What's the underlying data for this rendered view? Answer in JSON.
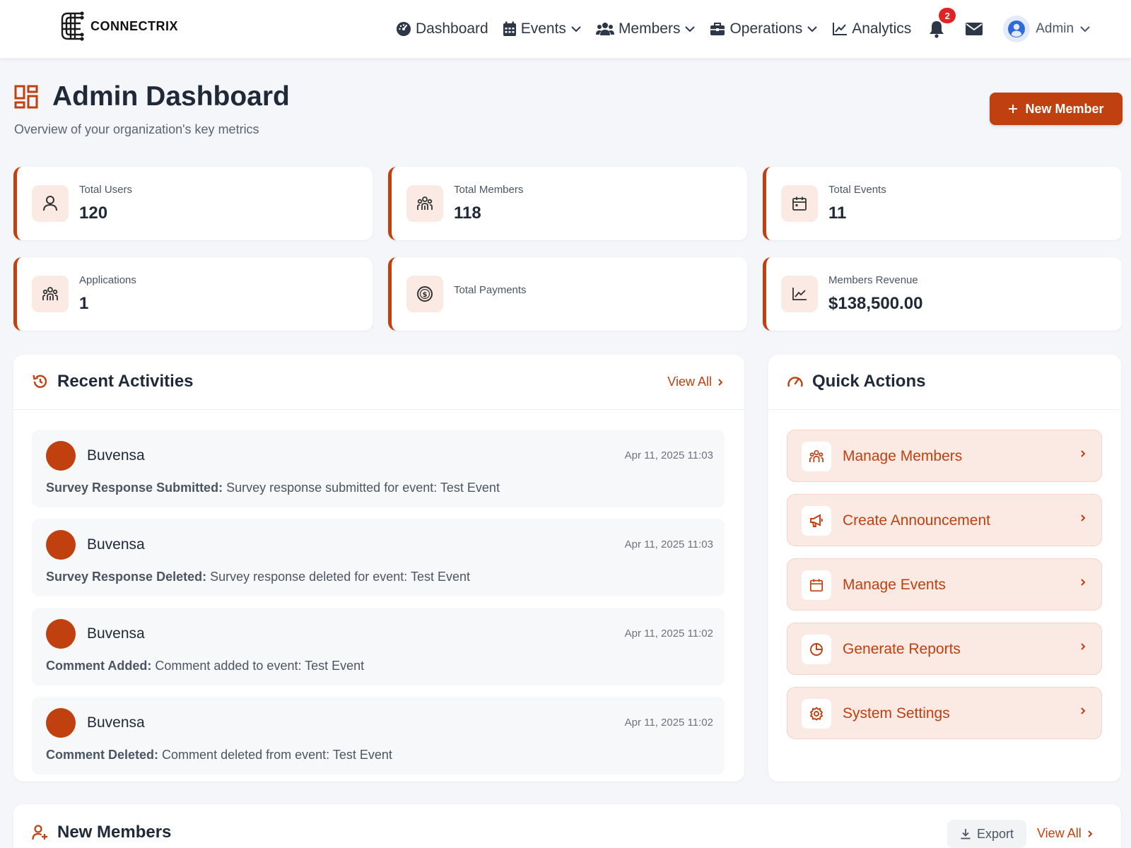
{
  "brand": {
    "name": "CONNECTRIX"
  },
  "nav": {
    "items": [
      {
        "label": "Dashboard",
        "icon": "gauge-icon",
        "dropdown": false
      },
      {
        "label": "Events",
        "icon": "calendar-grid-icon",
        "dropdown": true
      },
      {
        "label": "Members",
        "icon": "users-icon",
        "dropdown": true
      },
      {
        "label": "Operations",
        "icon": "briefcase-icon",
        "dropdown": true
      },
      {
        "label": "Analytics",
        "icon": "line-chart-icon",
        "dropdown": false
      }
    ],
    "notifications_count": "2",
    "user_label": "Admin"
  },
  "header": {
    "title": "Admin Dashboard",
    "subtitle": "Overview of your organization's key metrics",
    "new_member_label": "New Member"
  },
  "stats": [
    {
      "label": "Total Users",
      "value": "120",
      "icon": "user-icon"
    },
    {
      "label": "Total Members",
      "value": "118",
      "icon": "group-icon"
    },
    {
      "label": "Total Events",
      "value": "11",
      "icon": "calendar-icon"
    },
    {
      "label": "Applications",
      "value": "1",
      "icon": "group-icon"
    },
    {
      "label": "Total Payments",
      "value": "",
      "icon": "dollar-circle-icon"
    },
    {
      "label": "Members Revenue",
      "value": "$138,500.00",
      "icon": "trend-chart-icon"
    }
  ],
  "recent_activities": {
    "title": "Recent Activities",
    "view_all_label": "View All",
    "items": [
      {
        "user": "Buvensa",
        "time": "Apr 11, 2025 11:03",
        "action": "Survey Response Submitted:",
        "detail": "Survey response submitted for event: Test Event"
      },
      {
        "user": "Buvensa",
        "time": "Apr 11, 2025 11:03",
        "action": "Survey Response Deleted:",
        "detail": "Survey response deleted for event: Test Event"
      },
      {
        "user": "Buvensa",
        "time": "Apr 11, 2025 11:02",
        "action": "Comment Added:",
        "detail": "Comment added to event: Test Event"
      },
      {
        "user": "Buvensa",
        "time": "Apr 11, 2025 11:02",
        "action": "Comment Deleted:",
        "detail": "Comment deleted from event: Test Event"
      }
    ]
  },
  "quick_actions": {
    "title": "Quick Actions",
    "items": [
      {
        "label": "Manage Members",
        "icon": "group-icon"
      },
      {
        "label": "Create Announcement",
        "icon": "megaphone-icon"
      },
      {
        "label": "Manage Events",
        "icon": "calendar-icon"
      },
      {
        "label": "Generate Reports",
        "icon": "pie-chart-icon"
      },
      {
        "label": "System Settings",
        "icon": "gear-icon"
      }
    ]
  },
  "new_members": {
    "title": "New Members",
    "export_label": "Export",
    "view_all_label": "View All"
  },
  "colors": {
    "accent": "#c0400f",
    "accent_light": "#fbe9e3",
    "background": "#f4f6f9",
    "badge": "#e02424"
  }
}
